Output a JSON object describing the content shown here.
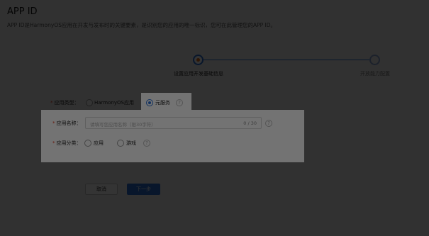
{
  "header": {
    "title": "APP ID",
    "subtitle": "APP ID是HarmonyOS应用在开发与发布时的关键要素，是识别您的应用的唯一标识，您可在此管理您的APP ID。"
  },
  "steps": [
    {
      "label": "设置应用开发基础信息"
    },
    {
      "label": "开放能力配置"
    }
  ],
  "form": {
    "type": {
      "label": "应用类型：",
      "options": [
        "HarmonyOS应用",
        "元服务"
      ],
      "selected": "元服务",
      "help": "?"
    },
    "name": {
      "label": "应用名称：",
      "placeholder": "请填写您应用名称（限30字符）",
      "count": "0 / 30",
      "help": "?"
    },
    "category": {
      "label": "应用分类：",
      "options": [
        "应用",
        "游戏"
      ],
      "help": "?"
    }
  },
  "actions": {
    "cancel_label": "取消",
    "next_label": "下一步"
  },
  "colors": {
    "accent": "#2b6fd6",
    "required": "#e84026",
    "step_marker": "#e8701a"
  }
}
